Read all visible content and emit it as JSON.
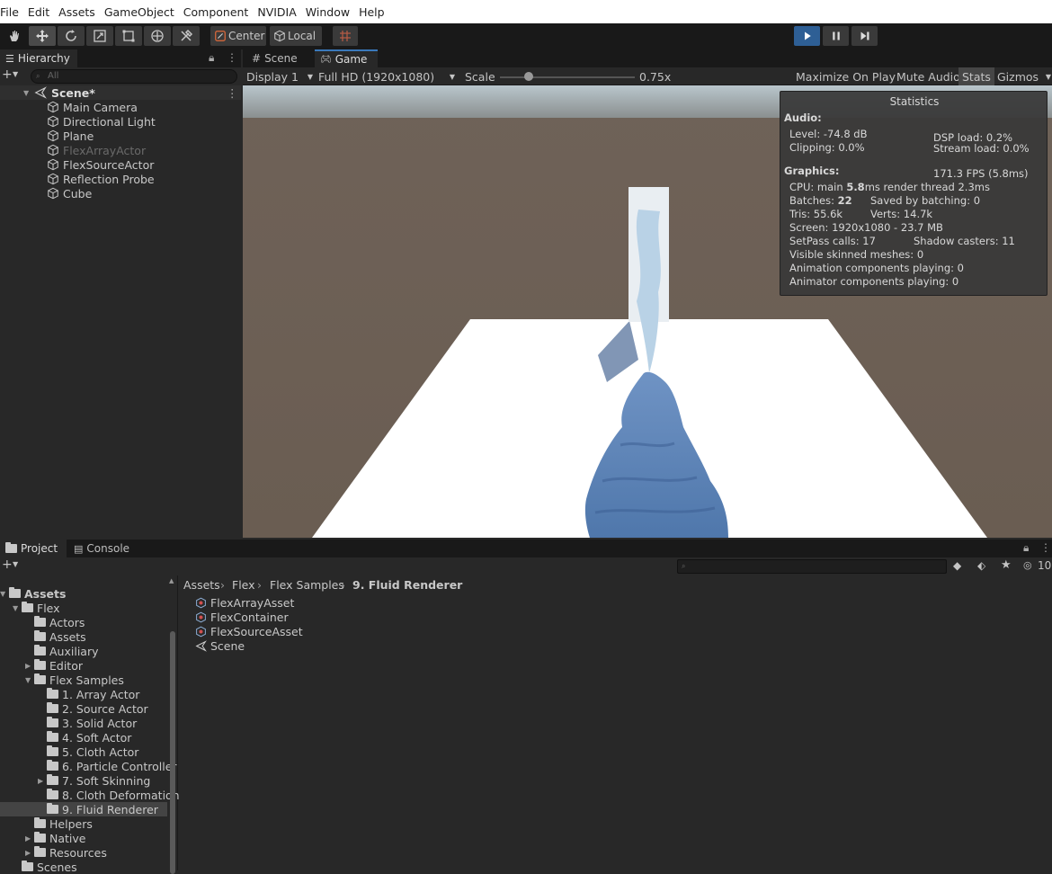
{
  "menu": [
    "File",
    "Edit",
    "Assets",
    "GameObject",
    "Component",
    "NVIDIA",
    "Window",
    "Help"
  ],
  "toolbar": {
    "tools": [
      "hand-icon",
      "move-icon",
      "rotate-icon",
      "scale-icon",
      "rect-icon",
      "transform-icon",
      "custom-tool-icon"
    ],
    "pivot_label": "Center",
    "space_label": "Local",
    "play_active": true
  },
  "hierarchy": {
    "tab": "Hierarchy",
    "search_placeholder": "All",
    "scene": "Scene*",
    "items": [
      {
        "label": "Main Camera",
        "dim": false
      },
      {
        "label": "Directional Light",
        "dim": false
      },
      {
        "label": "Plane",
        "dim": false
      },
      {
        "label": "FlexArrayActor",
        "dim": true
      },
      {
        "label": "FlexSourceActor",
        "dim": false
      },
      {
        "label": "Reflection Probe",
        "dim": false
      },
      {
        "label": "Cube",
        "dim": false
      }
    ]
  },
  "game": {
    "tab_scene": "Scene",
    "tab_game": "Game",
    "display": "Display 1",
    "resolution": "Full HD (1920x1080)",
    "scale_label": "Scale",
    "scale_value": "0.75x",
    "maximize": "Maximize On Play",
    "mute": "Mute Audio",
    "stats": "Stats",
    "gizmos": "Gizmos"
  },
  "stats": {
    "title": "Statistics",
    "audio_header": "Audio:",
    "level": "Level: -74.8 dB",
    "clipping": "Clipping: 0.0%",
    "dsp": "DSP load: 0.2%",
    "stream": "Stream load: 0.0%",
    "graphics_header": "Graphics:",
    "fps": "171.3 FPS (5.8ms)",
    "cpu_prefix": "CPU: main ",
    "cpu_main": "5.8",
    "cpu_suffix": "ms  render thread 2.3ms",
    "batches_prefix": "Batches: ",
    "batches": "22",
    "saved": "Saved by batching: 0",
    "tris": "Tris: 55.6k",
    "verts": "Verts: 14.7k",
    "screen": "Screen: 1920x1080 - 23.7 MB",
    "setpass": "SetPass calls: 17",
    "shadow": "Shadow casters: 11",
    "skinned": "Visible skinned meshes: 0",
    "animation": "Animation components playing: 0",
    "animator": "Animator components playing: 0"
  },
  "project": {
    "tab_project": "Project",
    "tab_console": "Console",
    "hidden_count": "10",
    "breadcrumb": [
      "Assets",
      "Flex",
      "Flex Samples",
      "9. Fluid Renderer"
    ],
    "tree": [
      {
        "label": "Assets",
        "bold": true
      },
      {
        "label": "Flex"
      },
      {
        "label": "Actors"
      },
      {
        "label": "Assets"
      },
      {
        "label": "Auxiliary"
      },
      {
        "label": "Editor"
      },
      {
        "label": "Flex Samples"
      },
      {
        "label": "1. Array Actor"
      },
      {
        "label": "2. Source Actor"
      },
      {
        "label": "3. Solid Actor"
      },
      {
        "label": "4. Soft Actor"
      },
      {
        "label": "5. Cloth Actor"
      },
      {
        "label": "6. Particle Controller"
      },
      {
        "label": "7. Soft Skinning"
      },
      {
        "label": "8. Cloth Deformation"
      },
      {
        "label": "9. Fluid Renderer",
        "selected": true
      },
      {
        "label": "Helpers"
      },
      {
        "label": "Native"
      },
      {
        "label": "Resources"
      },
      {
        "label": "Scenes"
      }
    ],
    "files": [
      {
        "label": "FlexArrayAsset",
        "icon": "flex-asset-icon"
      },
      {
        "label": "FlexContainer",
        "icon": "flex-asset-icon"
      },
      {
        "label": "FlexSourceAsset",
        "icon": "flex-asset-icon"
      },
      {
        "label": "Scene",
        "icon": "unity-scene-icon"
      }
    ]
  },
  "colors": {
    "accent": "#2e5f95",
    "selection": "#2c5d87",
    "water": "#5e84b8",
    "sky": "#b9c6cc",
    "ground": "#6a5d52"
  }
}
